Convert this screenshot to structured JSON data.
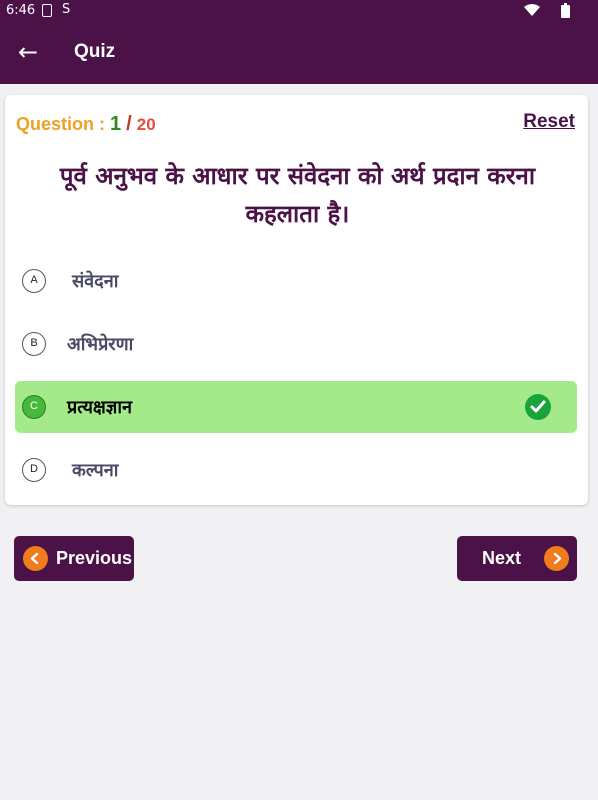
{
  "status_bar": {
    "time": "6:46",
    "icons": [
      "sd-card-icon",
      "sync-icon",
      "wifi-icon",
      "battery-icon"
    ]
  },
  "app_bar": {
    "back_icon": "arrow-left-icon",
    "title": "Quiz"
  },
  "quiz": {
    "counter_label": "Question :",
    "current": "1",
    "separator": "/",
    "total": "20",
    "reset_label": "Reset",
    "question": "पूर्व अनुभव के आधार पर संवेदना को अर्थ प्रदान करना कहलाता है।",
    "options": [
      {
        "letter": "A",
        "text": "संवेदना",
        "selected": false
      },
      {
        "letter": "B",
        "text": "अभिप्रेरणा",
        "selected": false
      },
      {
        "letter": "C",
        "text": "प्रत्यक्षज्ञान",
        "selected": true
      },
      {
        "letter": "D",
        "text": "कल्पना",
        "selected": false
      }
    ],
    "correct_icon": "check-circle-icon"
  },
  "navigation": {
    "previous_label": "Previous",
    "next_label": "Next"
  },
  "colors": {
    "primary": "#4b1248",
    "accent_orange": "#f07c1e",
    "counter_label": "#f0a022",
    "current_number": "#2c8a1e",
    "total_number": "#e74c3c",
    "selected_option_bg": "#a4ea8a",
    "check_green": "#1aa33a"
  }
}
